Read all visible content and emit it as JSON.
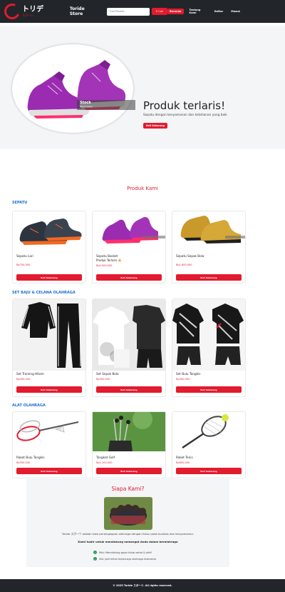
{
  "brand": {
    "logo_jp": "トリデ",
    "logo_sub": "スポーツ",
    "store_name": "Toride Store"
  },
  "search": {
    "placeholder": "Cari Produk...",
    "button_label": "Cari"
  },
  "nav": {
    "items": [
      {
        "label": "Beranda",
        "active": true
      },
      {
        "label": "Tentang Kami",
        "active": false
      },
      {
        "label": "Daftar",
        "active": false
      },
      {
        "label": "Masuk",
        "active": false
      }
    ]
  },
  "hero": {
    "caption_title": "Stock",
    "caption_sub": "Stock ready",
    "title": "Produk terlaris!",
    "subtitle": "Sepatu dengan kenyamanan dan ketahanan yang baik",
    "button_label": "Beli Sekarang"
  },
  "products_heading": "Produk Kami",
  "categories": [
    {
      "title": "SEPATU",
      "items": [
        {
          "name": "Sepatu Lari",
          "desc": "",
          "price": "Rp750.000",
          "button": "Beli Sekarang"
        },
        {
          "name": "Sepatu Basket",
          "desc": "Produk Terlaris 🔥",
          "price": "Rp2.000.000",
          "button": "Beli Sekarang"
        },
        {
          "name": "Sepatu Sepak Bola",
          "desc": "",
          "price": "Rp1.600.000",
          "button": "Beli Sekarang"
        }
      ]
    },
    {
      "title": "SET BAJU & CELANA OLAHRAGA",
      "items": [
        {
          "name": "Set Training Hitam",
          "desc": "",
          "price": "Rp450.000",
          "button": "Beli Sekarang"
        },
        {
          "name": "Set Sepak Bola",
          "desc": "",
          "price": "Rp350.000",
          "button": "Beli Sekarang"
        },
        {
          "name": "Set Bulu Tangkis",
          "desc": "",
          "price": "Rp300.000",
          "button": "Beli Sekarang"
        }
      ]
    },
    {
      "title": "ALAT OLAHRAGA",
      "items": [
        {
          "name": "Raket Bulu Tangkis",
          "desc": "",
          "price": "Rp350.000",
          "button": "Beli Sekarang"
        },
        {
          "name": "Tongkat Golf",
          "desc": "",
          "price": "Rp1.200.000",
          "button": "Beli Sekarang"
        },
        {
          "name": "Raket Tenis",
          "desc": "",
          "price": "Rp650.000",
          "button": "Beli Sekarang"
        }
      ]
    }
  ],
  "about": {
    "title": "Siapa Kami?",
    "p1": "Toride スポーツ adalah toko perlengkapan olahraga dengan fokus pada kualitas dan kenyamanan.",
    "p2": "Kami hadir untuk mendukung semangat Anda dalam berolahraga",
    "list": [
      "Misi: Mendukung gaya hidup sehat & aktif",
      "Visi: Jadi mitra terpercaya olahraga Indonesia"
    ]
  },
  "footer": "© 2025 Toride スポーツ. All rights reserved.",
  "colors": {
    "accent": "#e21b2e",
    "nav_bg": "#22262b",
    "category": "#1f6fd1"
  }
}
